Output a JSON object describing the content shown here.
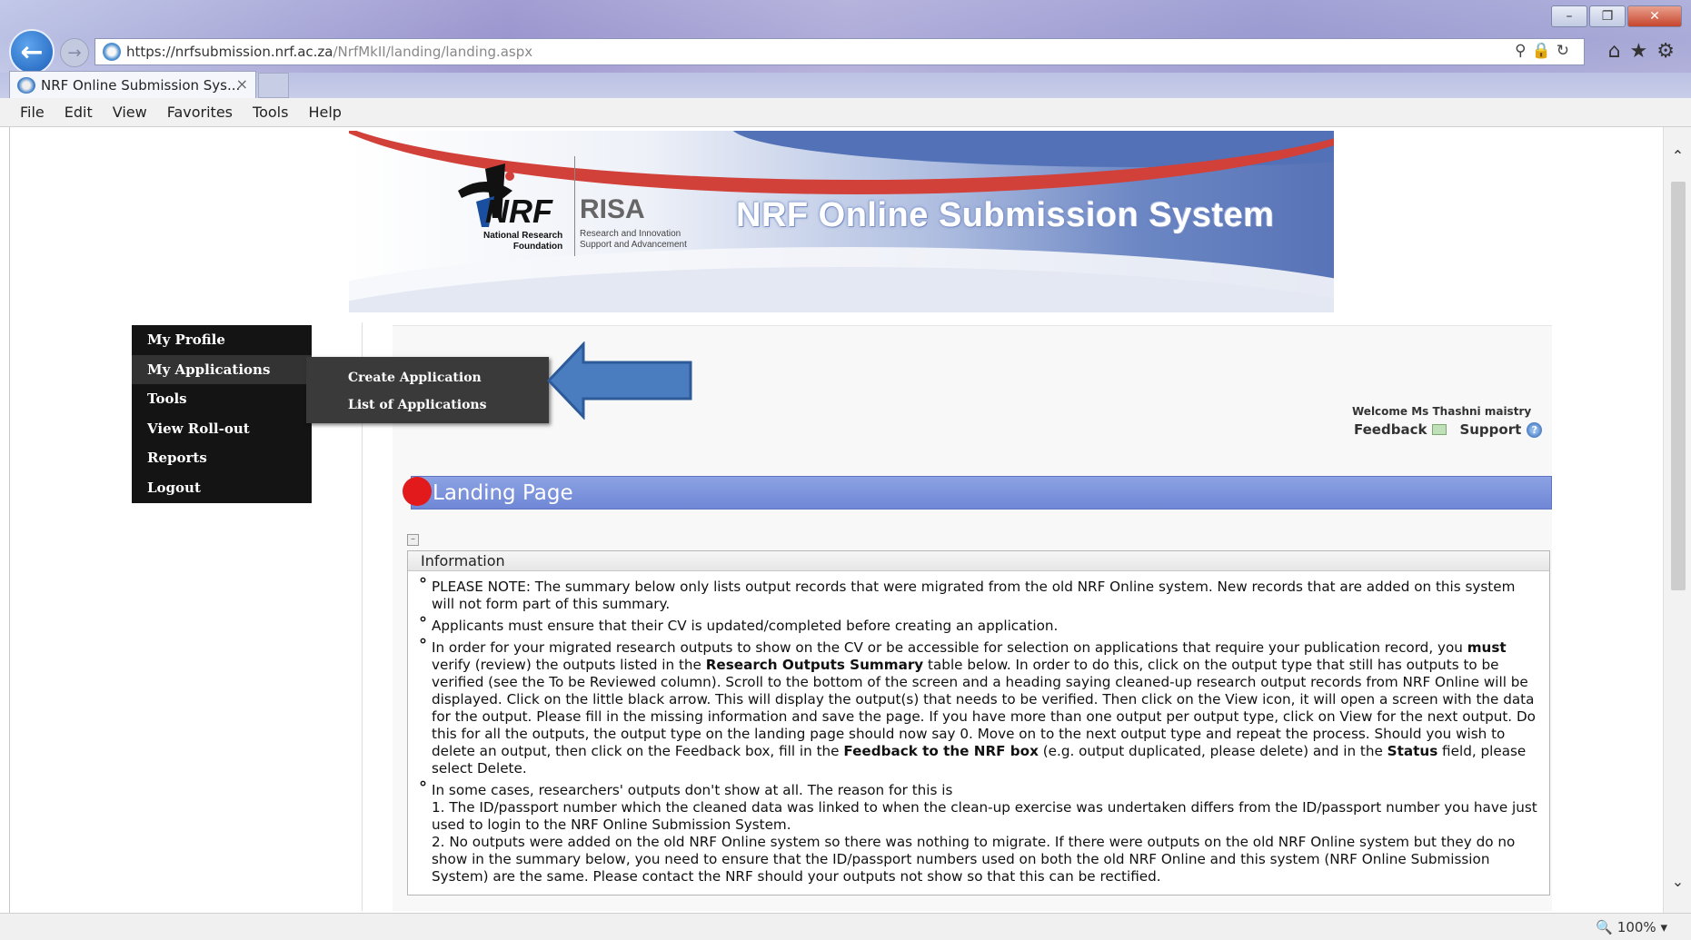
{
  "browser": {
    "url_host": "https://nrfsubmission.nrf.ac.za",
    "url_path": "/NrfMkII/landing/landing.aspx",
    "tab_title": "NRF Online Submission Sys...",
    "tab_close": "×",
    "menu": [
      "File",
      "Edit",
      "View",
      "Favorites",
      "Tools",
      "Help"
    ],
    "zoom": "100%",
    "icons": [
      "back-icon",
      "forward-icon",
      "search-icon",
      "lock-icon",
      "refresh-icon",
      "home-icon",
      "favorites-star-icon",
      "settings-gear-icon"
    ]
  },
  "banner": {
    "logo_nrf": "NRF",
    "logo_nrf_sub1": "National Research",
    "logo_nrf_sub2": "Foundation",
    "logo_risa": "RISA",
    "logo_risa_sub1": "Research and Innovation",
    "logo_risa_sub2": "Support and Advancement",
    "title": "NRF Online Submission System"
  },
  "nav": {
    "items": [
      "My Profile",
      "My Applications",
      "Tools",
      "View Roll-out",
      "Reports",
      "Logout"
    ],
    "active": "My Applications",
    "submenu": [
      "Create Application",
      "List of Applications"
    ]
  },
  "user": {
    "welcome": "Welcome Ms Thashni maistry",
    "feedback": "Feedback",
    "support": "Support"
  },
  "page": {
    "title": "Landing Page",
    "info_header": "Information",
    "items": [
      "PLEASE NOTE: The summary below only lists output records that were migrated from the old NRF Online system. New records that are added on this system will not form part of this summary.",
      "Applicants must ensure that their CV is updated/completed before creating an application."
    ],
    "item3": {
      "p1": "In order for your migrated research outputs to show on the CV or be accessible for selection on applications that require your publication record, you ",
      "b1": "must",
      "p2": " verify (review) the outputs listed in the ",
      "b2": "Research Outputs Summary",
      "p3": " table below. In order to do this, click on the output type that still has outputs to be verified (see the To be Reviewed column). Scroll to the bottom of the screen and a heading saying cleaned-up research output records from NRF Online will be displayed. Click on the little black arrow. This will display the output(s) that needs to be verified. Then click on the View icon, it will open a screen with the data for the output. Please fill in the missing information and save the page. If you have more than one output per output type, click on View for the next output. Do this for all the outputs, the output type on the landing page should now say 0. Move on to the next output type and repeat the process. Should you wish to delete an output, then click on the Feedback box, fill in the ",
      "b3": "Feedback to the NRF box",
      "p4": " (e.g. output duplicated, please delete) and in the ",
      "b4": "Status",
      "p5": " field, please select Delete."
    },
    "item4": {
      "intro": "In some cases, researchers' outputs don't show at all. The reason for this is",
      "reason1": "1. The ID/passport number which the cleaned data was linked to when the clean-up exercise was undertaken differs from the ID/passport number you have just used to login to the NRF Online Submission System.",
      "reason2": "2. No outputs were added on the old NRF Online system so there was nothing to migrate. If there were outputs on the old NRF Online system but they do no show in the summary below, you need to ensure that the ID/passport numbers used on both the old NRF Online and this system (NRF Online Submission System) are the same. Please contact the NRF should your outputs not show so that this can be rectified."
    }
  },
  "colors": {
    "nav_bg": "#141414",
    "landing_bar": "#7b91dc",
    "landing_dot": "#e31a1c",
    "arrow": "#4a7cc0"
  }
}
